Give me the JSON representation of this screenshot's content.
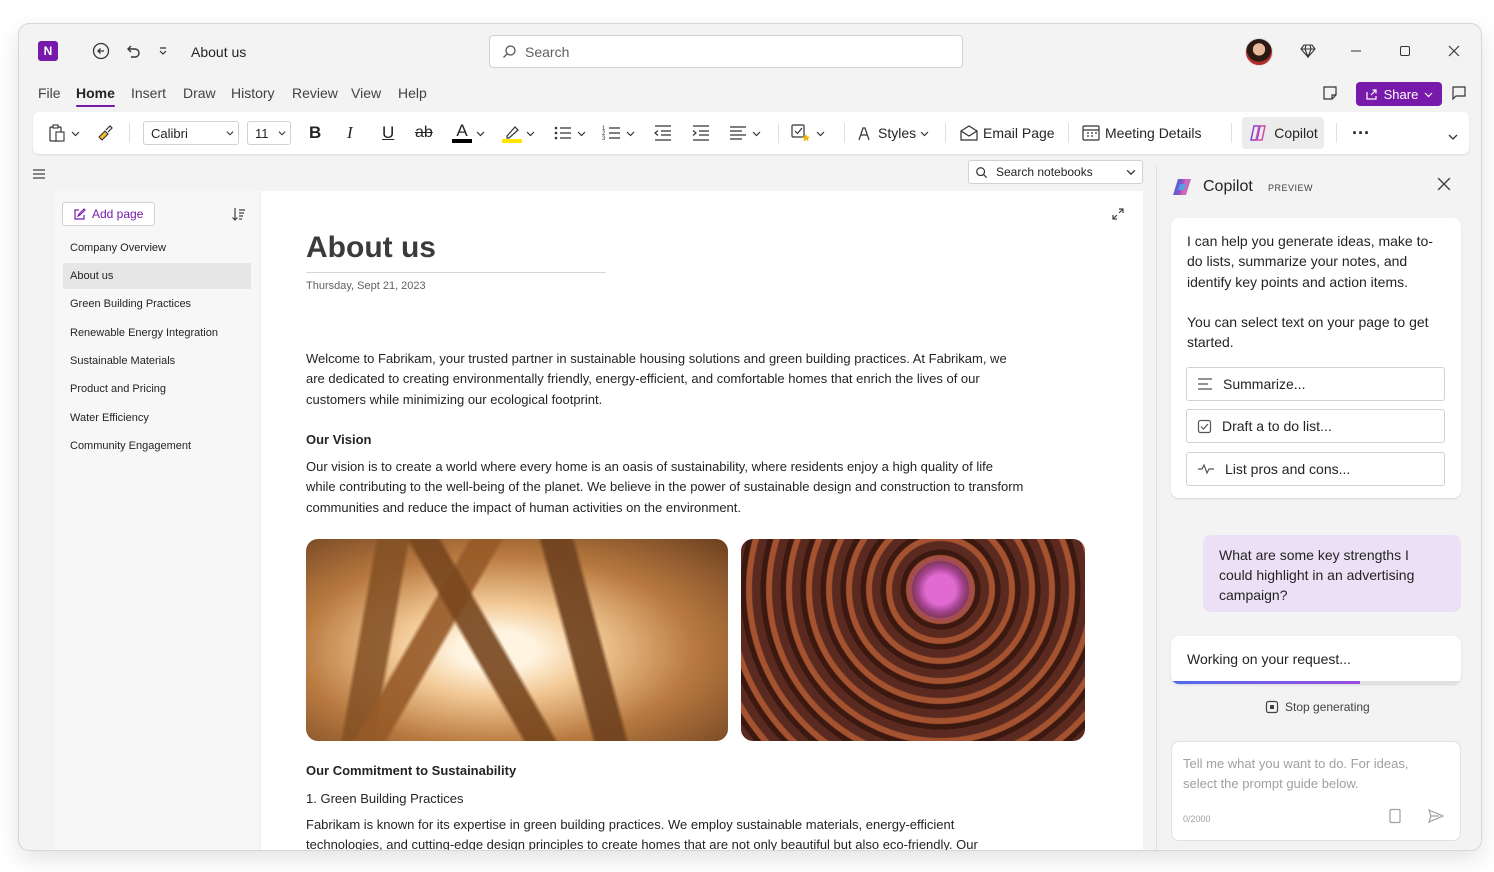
{
  "titlebar": {
    "app_logo": "N",
    "doc_title": "About us",
    "search_placeholder": "Search",
    "icons": [
      "back-icon",
      "undo-icon",
      "customize-dropdown-icon",
      "premium-diamond-icon",
      "minimize-icon",
      "maximize-icon",
      "close-icon"
    ]
  },
  "menu": {
    "items": [
      "File",
      "Home",
      "Insert",
      "Draw",
      "History",
      "Review",
      "View",
      "Help"
    ],
    "active": "Home",
    "share_label": "Share"
  },
  "ribbon": {
    "font_name": "Calibri",
    "font_size": "11",
    "bold": "B",
    "italic": "I",
    "underline": "U",
    "strike": "ab",
    "font_color_letter": "A",
    "font_color": "#000000",
    "highlight_color": "#ffe600",
    "styles_label": "Styles",
    "email_page_label": "Email Page",
    "meeting_details_label": "Meeting Details",
    "copilot_label": "Copilot",
    "more_label": "···"
  },
  "notebook_search_placeholder": "Search notebooks",
  "pagelist": {
    "add_page_label": "Add page",
    "items": [
      "Company Overview",
      "About us",
      "Green Building Practices",
      "Renewable Energy Integration",
      "Sustainable Materials",
      "Product and Pricing",
      "Water Efficiency",
      "Community Engagement"
    ],
    "active_index": 1
  },
  "page": {
    "title": "About us",
    "date": "Thursday, Sept 21, 2023",
    "intro": "Welcome to Fabrikam, your trusted partner in sustainable housing solutions and green building practices. At Fabrikam, we are dedicated to creating environmentally friendly, energy-efficient, and comfortable homes that enrich the lives of our customers while minimizing our ecological footprint.",
    "vision_heading": "Our Vision",
    "vision_text": "Our vision is to create a world where every home is an oasis of sustainability, where residents enjoy a high quality of life while contributing to the well-being of the planet. We believe in the power of sustainable design and construction to transform communities and reduce the impact of human activities on the environment.",
    "commitment_heading": "Our Commitment to Sustainability",
    "commitment_item": "1. Green Building Practices",
    "commitment_text": "Fabrikam is known for its expertise in green building practices. We employ sustainable materials, energy-efficient technologies, and cutting-edge design principles to create homes that are not only beautiful but also eco-friendly. Our buildings are designed to achieve high levels of energy efficiency, reducing utility costs and carbon emissions."
  },
  "copilot": {
    "title": "Copilot",
    "badge": "PREVIEW",
    "intro_1": "I can help you generate ideas, make to-do lists, summarize your notes, and identify key points and action items.",
    "intro_2": "You can select text on your page to get started.",
    "suggestions": [
      "Summarize...",
      "Draft a to do list...",
      "List pros and cons..."
    ],
    "user_message": "What are some key strengths I could highlight in an advertising campaign?",
    "working_text": "Working on your request...",
    "progress": 0.65,
    "stop_label": "Stop generating",
    "input_placeholder": "Tell me what you want to do. For ideas, select the prompt guide below.",
    "char_count": "0/2000"
  }
}
